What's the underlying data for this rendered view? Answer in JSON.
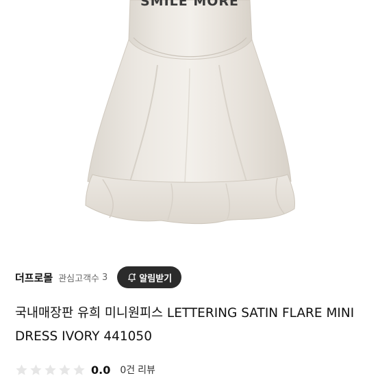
{
  "product_image": {
    "print_text": "SMILE MORE"
  },
  "seller": {
    "name": "더프로몰",
    "follower_label": "관심고객수",
    "follower_count": "3",
    "alert_button_label": "알림받기",
    "alert_icon": "bell-plus-icon"
  },
  "product": {
    "title": "국내매장판 유희 미니원피스 LETTERING SATIN FLARE MINI DRESS IVORY 441050"
  },
  "rating": {
    "value": "0.0",
    "stars_filled": 0,
    "stars_total": 5,
    "star_icon": "star-icon",
    "review_count": "0건",
    "review_label": "리뷰"
  },
  "colors": {
    "button_bg": "#2b2b2b",
    "star_empty": "#e6e6e6",
    "dress": "#ece8e2"
  }
}
